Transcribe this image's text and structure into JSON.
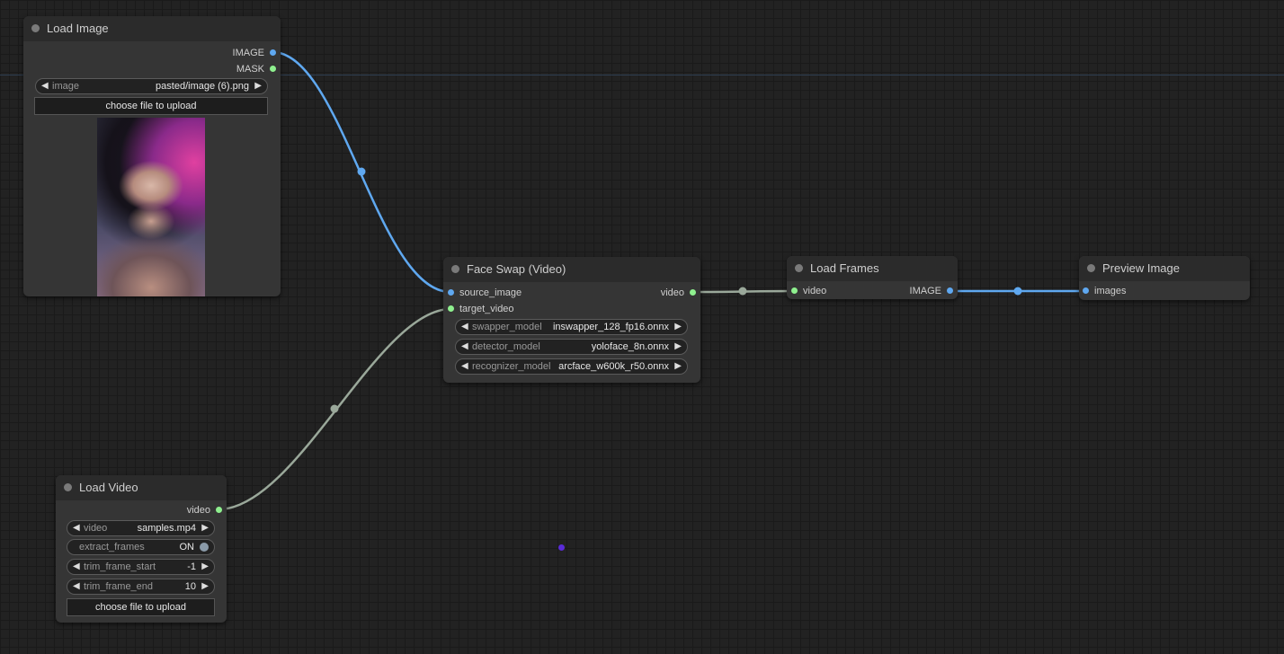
{
  "nodes": {
    "load_image": {
      "title": "Load Image",
      "outputs": [
        "IMAGE",
        "MASK"
      ],
      "image_widget": {
        "label": "image",
        "value": "pasted/image (6).png"
      },
      "upload_label": "choose file to upload"
    },
    "face_swap": {
      "title": "Face Swap (Video)",
      "inputs": [
        "source_image",
        "target_video"
      ],
      "output": "video",
      "widgets": [
        {
          "label": "swapper_model",
          "value": "inswapper_128_fp16.onnx"
        },
        {
          "label": "detector_model",
          "value": "yoloface_8n.onnx"
        },
        {
          "label": "recognizer_model",
          "value": "arcface_w600k_r50.onnx"
        }
      ]
    },
    "load_frames": {
      "title": "Load Frames",
      "input": "video",
      "output": "IMAGE"
    },
    "preview_image": {
      "title": "Preview Image",
      "input": "images"
    },
    "load_video": {
      "title": "Load Video",
      "output": "video",
      "widgets": {
        "video": {
          "label": "video",
          "value": "samples.mp4"
        },
        "extract_frames": {
          "label": "extract_frames",
          "value": "ON"
        },
        "trim_frame_start": {
          "label": "trim_frame_start",
          "value": "-1"
        },
        "trim_frame_end": {
          "label": "trim_frame_end",
          "value": "10"
        }
      },
      "upload_label": "choose file to upload"
    }
  },
  "colors": {
    "image_link": "#5fa8f0",
    "video_link": "#9aa89a",
    "image_pin": "#5fa8f0",
    "video_pin": "#8ff08f",
    "background": "#222222",
    "node": "#353535",
    "node_title": "#2b2b2b"
  },
  "icons": {
    "title_dot": "circle",
    "arrow_left": "triangle-left",
    "arrow_right": "triangle-right",
    "toggle": "circle-knob"
  }
}
